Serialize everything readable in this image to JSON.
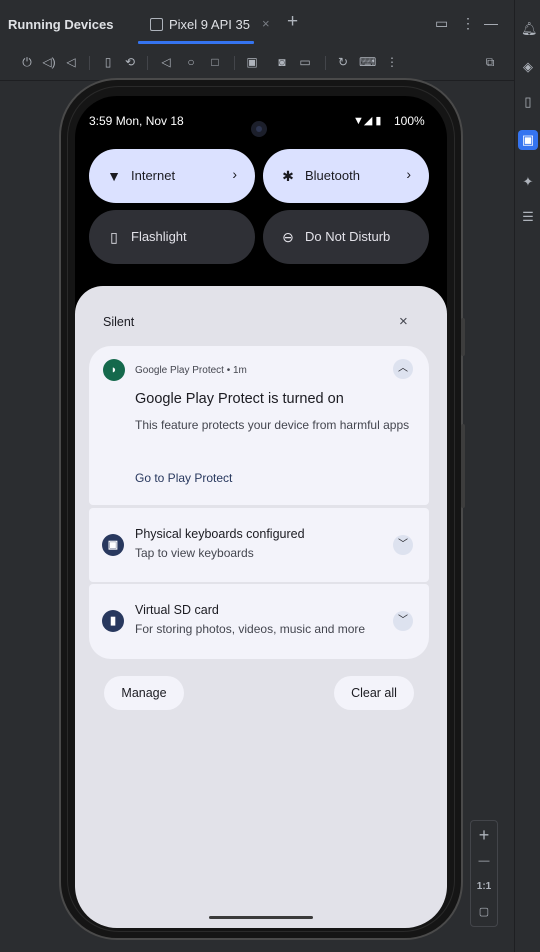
{
  "ide": {
    "panel_title": "Running Devices",
    "tab_label": "Pixel 9 API 35",
    "tab_close": "×",
    "tab_add": "+"
  },
  "zoom": {
    "plus": "+",
    "minus": "—",
    "ratio": "1:1"
  },
  "device": {
    "status": {
      "time_date": "3:59  Mon, Nov 18",
      "battery": "100%"
    },
    "tiles": [
      {
        "label": "Internet",
        "state": "on",
        "chevron": "›"
      },
      {
        "label": "Bluetooth",
        "state": "on",
        "chevron": "›"
      },
      {
        "label": "Flashlight",
        "state": "off"
      },
      {
        "label": "Do Not Disturb",
        "state": "off"
      }
    ],
    "shade": {
      "section_title": "Silent",
      "close": "×",
      "notifications": [
        {
          "app": "Google Play Protect • 1m",
          "title": "Google Play Protect is turned on",
          "body": "This feature protects your device from harmful apps",
          "action": "Go to Play Protect",
          "expanded": true
        },
        {
          "title": "Physical keyboards configured",
          "body": "Tap to view keyboards",
          "expanded": false
        },
        {
          "title": "Virtual SD card",
          "body": "For storing photos, videos, music and more",
          "expanded": false
        }
      ],
      "manage_label": "Manage",
      "clear_all_label": "Clear all"
    }
  },
  "colors": {
    "ide_bg": "#2b2d30",
    "accent_blue": "#3574f0",
    "tile_on": "#dbe1ff",
    "tile_off": "#2f3036",
    "shade_bg": "#e2e2e9",
    "card_bg": "#f3f3fa",
    "play_protect_green": "#15694c"
  }
}
